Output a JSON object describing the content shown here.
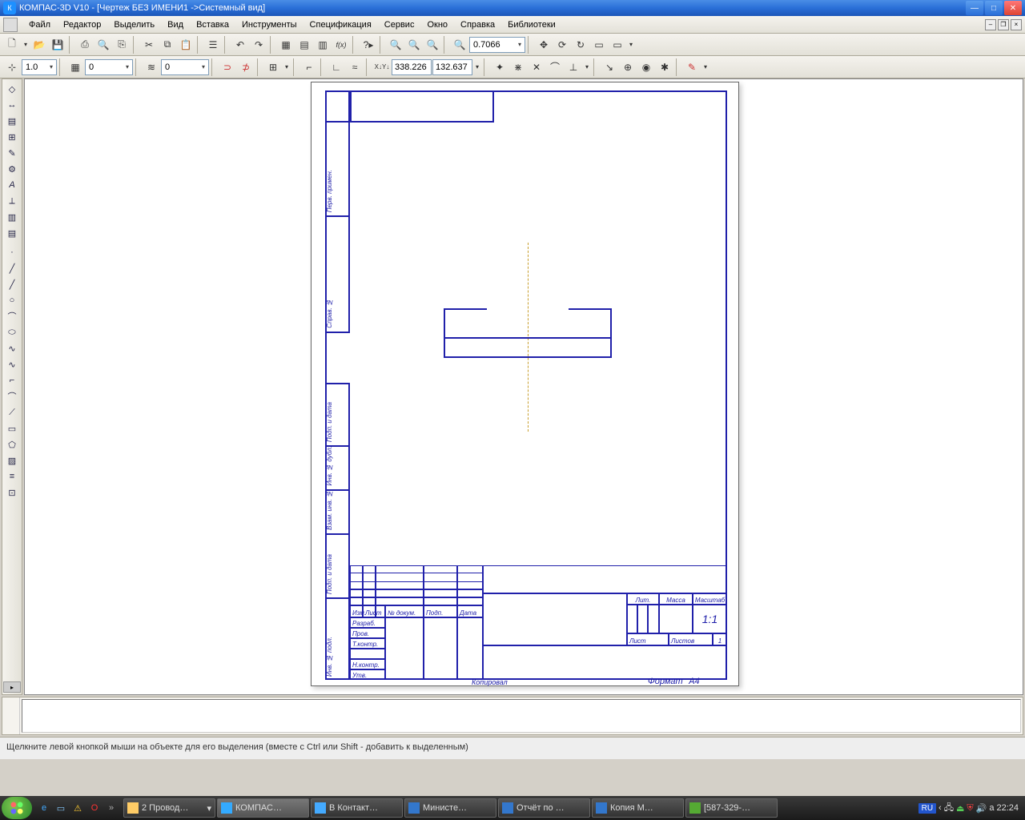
{
  "title": "КОМПАС-3D V10 - [Чертеж БЕЗ ИМЕНИ1 ->Системный вид]",
  "menu": {
    "file": "Файл",
    "edit": "Редактор",
    "select": "Выделить",
    "view": "Вид",
    "insert": "Вставка",
    "tools": "Инструменты",
    "spec": "Спецификация",
    "service": "Сервис",
    "window": "Окно",
    "help": "Справка",
    "libs": "Библиотеки"
  },
  "toolbar1": {
    "zoom_value": "0.7066"
  },
  "toolbar2": {
    "step": "1.0",
    "style_num": "0",
    "layer": "0",
    "coord_x": "338.226",
    "coord_y": "132.637"
  },
  "titleblock": {
    "lit": "Лит.",
    "massa": "Масса",
    "mashtab": "Масштаб",
    "scale": "1:1",
    "list": "Лист",
    "listov": "Листов",
    "listov_n": "1",
    "izm": "Изм.",
    "list2": "Лист",
    "ndokum": "№ докум.",
    "podp": "Подп.",
    "data": "Дата",
    "razrab": "Разраб.",
    "prov": "Пров.",
    "tkontr": "Т.контр.",
    "nkontr": "Н.контр.",
    "utv": "Утв.",
    "kopiroval": "Копировал",
    "format": "Формат",
    "format_v": "А4"
  },
  "side_labels": {
    "perv": "Перв. примен.",
    "sprav": "Справ. №",
    "podp_data": "Подп. и дата",
    "inv_dubl": "Инв. № дубл.",
    "vzam": "Взам. инв. №",
    "podp_data2": "Подп. и дата",
    "inv_podl": "Инв. № подл."
  },
  "status": "Щелкните левой кнопкой мыши на объекте для его выделения (вместе с Ctrl или Shift - добавить к выделенным)",
  "taskbar": {
    "t1": "2 Провод…",
    "t2": "КОМПАС…",
    "t3": "В Контакт…",
    "t4": "Министе…",
    "t5": "Отчёт по …",
    "t6": "Копия М…",
    "t7": "[587-329-…",
    "lang": "RU",
    "time": "22:24"
  }
}
